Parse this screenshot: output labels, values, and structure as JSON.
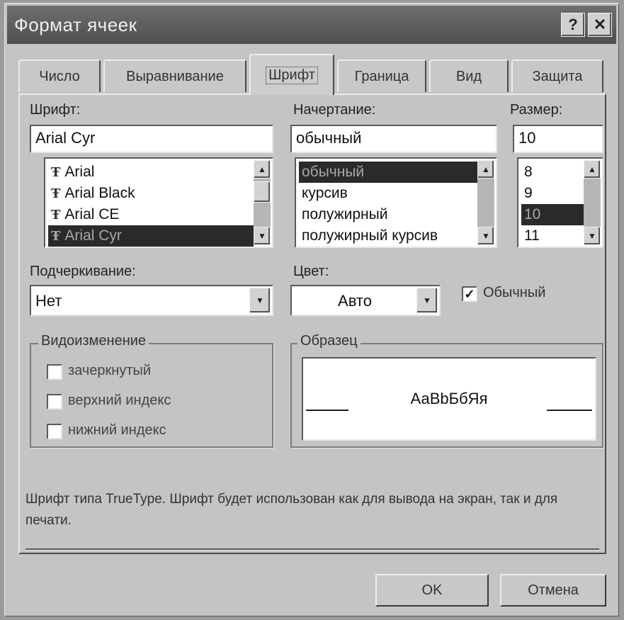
{
  "window": {
    "title": "Формат ячеек",
    "help_glyph": "?",
    "close_glyph": "✕"
  },
  "tabs": [
    {
      "label": "Число"
    },
    {
      "label": "Выравнивание"
    },
    {
      "label": "Шрифт"
    },
    {
      "label": "Граница"
    },
    {
      "label": "Вид"
    },
    {
      "label": "Защита"
    }
  ],
  "active_tab": "Шрифт",
  "font": {
    "label": "Шрифт:",
    "value": "Arial Cyr",
    "list": [
      "Arial",
      "Arial Black",
      "Arial CE",
      "Arial Cyr"
    ],
    "selected": "Arial Cyr",
    "item_icon": "truetype-icon",
    "item_icon_glyph": "Ŧ"
  },
  "style": {
    "label": "Начертание:",
    "value": "обычный",
    "list": [
      "обычный",
      "курсив",
      "полужирный",
      "полужирный курсив"
    ],
    "selected": "обычный"
  },
  "size": {
    "label": "Размер:",
    "value": "10",
    "list": [
      "8",
      "9",
      "10",
      "11"
    ],
    "selected": "10"
  },
  "underline": {
    "label": "Подчеркивание:",
    "value": "Нет"
  },
  "color": {
    "label": "Цвет:",
    "value": "Авто"
  },
  "normal_font": {
    "label": "Обычный",
    "checked": true,
    "check_glyph": "✓"
  },
  "effects": {
    "title": "Видоизменение",
    "items": [
      {
        "label": "зачеркнутый",
        "checked": false
      },
      {
        "label": "верхний индекс",
        "checked": false
      },
      {
        "label": "нижний индекс",
        "checked": false
      }
    ]
  },
  "sample": {
    "title": "Образец",
    "text": "АаВbБбЯя"
  },
  "description": "Шрифт типа TrueType. Шрифт будет использован как для вывода на экран, так и для печати.",
  "buttons": {
    "ok": "OK",
    "cancel": "Отмена"
  },
  "scroll_glyphs": {
    "up": "▲",
    "down": "▼"
  },
  "colors": {
    "selection": "#2a2a2a",
    "titlebar": "#5a5a5a",
    "dialog_bg": "#c4c4c4"
  }
}
